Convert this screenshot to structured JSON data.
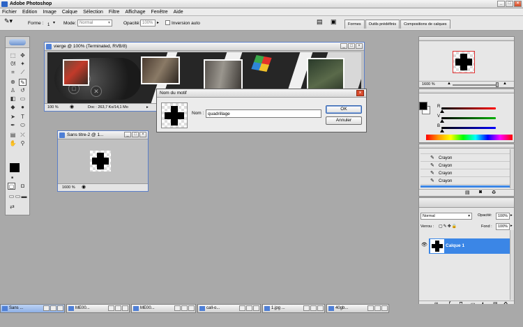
{
  "app": {
    "title": "Adobe Photoshop"
  },
  "menu": [
    "Fichier",
    "Edition",
    "Image",
    "Calque",
    "Sélection",
    "Filtre",
    "Affichage",
    "Fenêtre",
    "Aide"
  ],
  "options_bar": {
    "forme_label": "Forme :",
    "forme_value": "1",
    "mode_label": "Mode:",
    "mode_value": "Normal",
    "opacity_label": "Opacité:",
    "opacity_value": "100%",
    "auto_label": "Inversion auto"
  },
  "palette_tabs": [
    "Formes",
    "Outils prédéfinis",
    "Compositions de calques"
  ],
  "doc1": {
    "title": "vierge @ 100% (Terminated, RVB/8)",
    "zoom": "100 %",
    "info": "Doc : 263,7 Ko/14,1 Mo"
  },
  "doc2": {
    "title": "Sans titre-2 @ 1...",
    "zoom": "1600 %"
  },
  "dialog": {
    "title": "Nom du motif",
    "name_label": "Nom :",
    "name_value": "quadrillage",
    "ok": "OK",
    "cancel": "Annuler"
  },
  "navigator": {
    "zoom": "1600 %"
  },
  "color": {
    "r_label": "R",
    "v_label": "V",
    "b_label": "B"
  },
  "history": {
    "items": [
      "Crayon",
      "Crayon",
      "Crayon",
      "Crayon"
    ]
  },
  "layers": {
    "mode": "Normal",
    "opacity_label": "Opacité:",
    "opacity_value": "100%",
    "lock_label": "Verrou :",
    "fill_label": "Fond :",
    "fill_value": "100%",
    "layer_name": "Calque 1"
  },
  "taskbar": [
    "Sans ...",
    "ME00...",
    "ME00...",
    "call-o...",
    "1.jpg ...",
    "40gb..."
  ]
}
